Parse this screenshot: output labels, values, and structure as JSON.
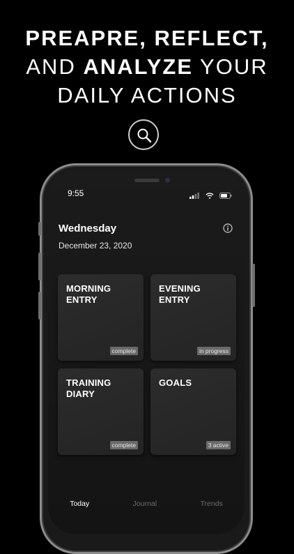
{
  "headline": {
    "line1": "PREAPRE, REFLECT,",
    "line2_a": "AND ",
    "line2_b": "ANALYZE",
    "line2_c": " YOUR",
    "line3": "DAILY ACTIONS"
  },
  "icons": {
    "badge": "search-icon"
  },
  "status_bar": {
    "time": "9:55"
  },
  "header": {
    "day": "Wednesday",
    "date": "December 23, 2020"
  },
  "cards": [
    {
      "title": "MORNING\nENTRY",
      "badge": "complete"
    },
    {
      "title": "EVENING\nENTRY",
      "badge": "in progress"
    },
    {
      "title": "TRAINING\nDIARY",
      "badge": "complete"
    },
    {
      "title": "GOALS",
      "badge": "3 active"
    }
  ],
  "tabs": [
    {
      "label": "Today",
      "active": true
    },
    {
      "label": "Journal",
      "active": false
    },
    {
      "label": "Trends",
      "active": false
    }
  ]
}
